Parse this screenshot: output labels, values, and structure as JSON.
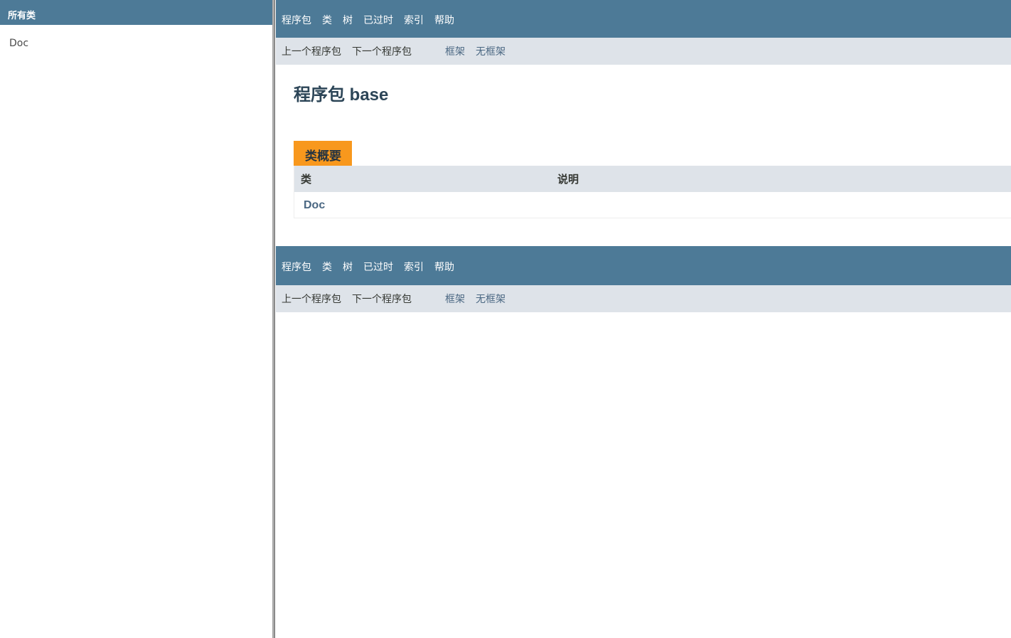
{
  "left_frame": {
    "header": "所有类",
    "classes": [
      "Doc"
    ]
  },
  "top_nav": {
    "items": [
      "程序包",
      "类",
      "树",
      "已过时",
      "索引",
      "帮助"
    ]
  },
  "sub_nav": {
    "prev_package": "上一个程序包",
    "next_package": "下一个程序包",
    "frames": "框架",
    "no_frames": "无框架"
  },
  "page": {
    "title": "程序包 base"
  },
  "class_summary": {
    "caption": "类概要",
    "columns": [
      "类",
      "说明"
    ],
    "rows": [
      {
        "class": "Doc",
        "description": ""
      }
    ]
  },
  "colors": {
    "nav_bar": "#4d7a97",
    "sub_nav": "#dee3e9",
    "caption_tab": "#f8981d",
    "link": "#4a6782"
  }
}
